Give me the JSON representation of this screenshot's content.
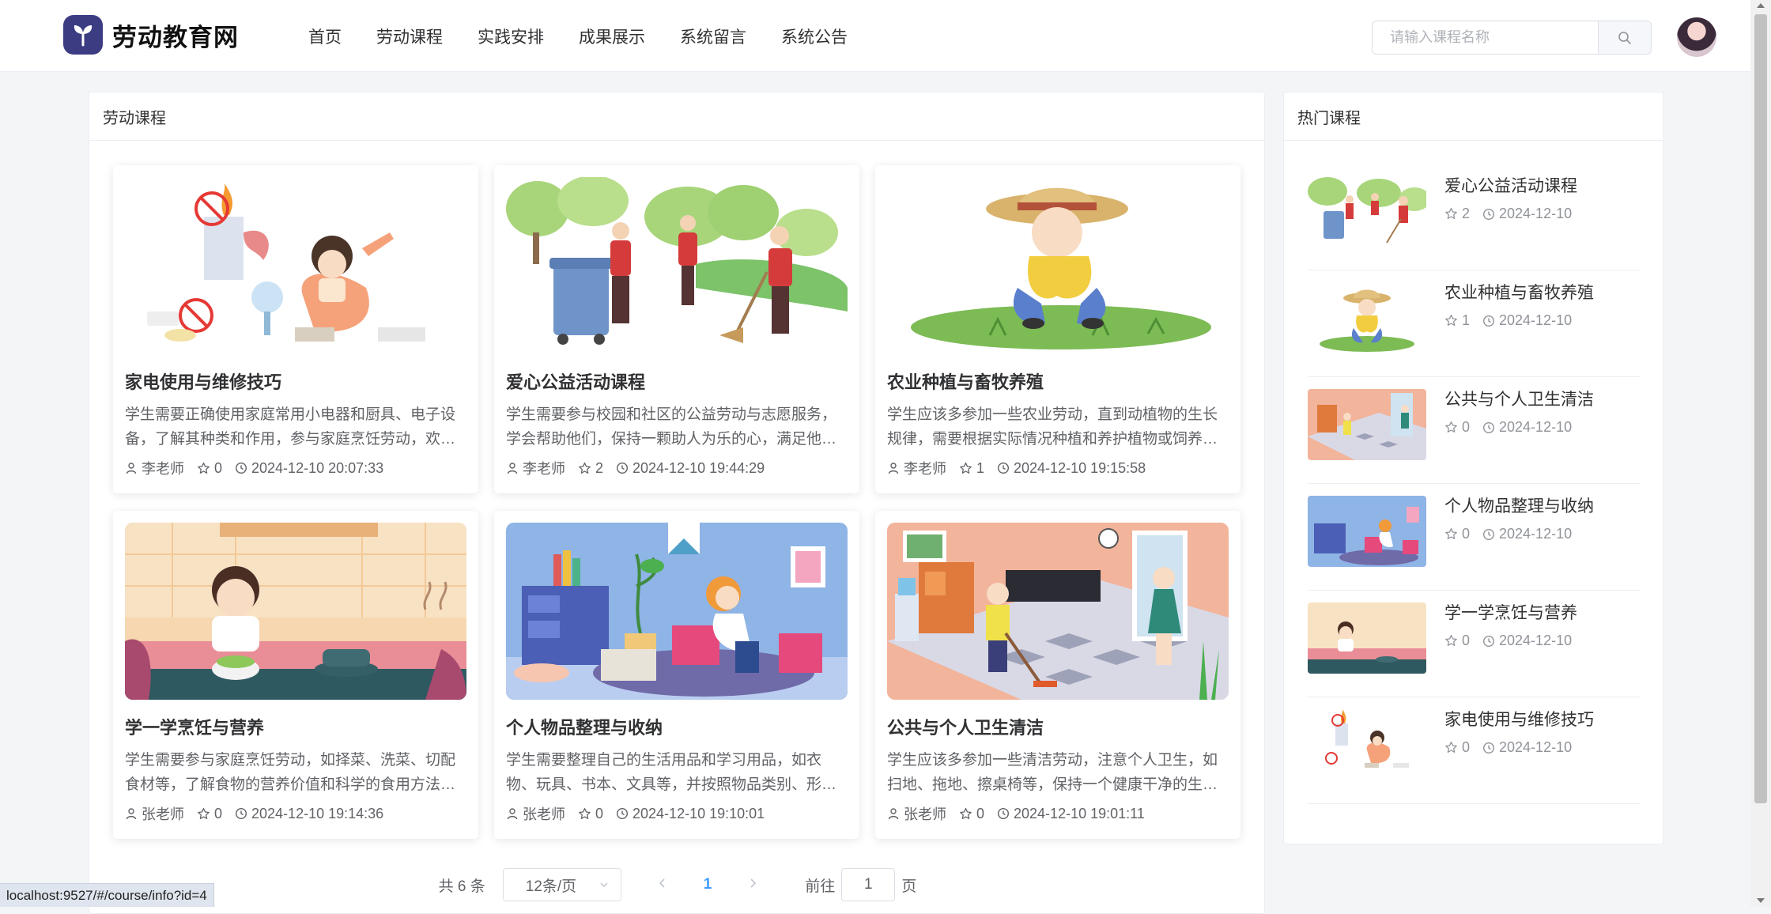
{
  "brand": {
    "name": "劳动教育网",
    "logo_icon": "heart-leaf-icon",
    "accent": "#3c3c83"
  },
  "nav": {
    "items": [
      {
        "label": "首页"
      },
      {
        "label": "劳动课程"
      },
      {
        "label": "实践安排"
      },
      {
        "label": "成果展示"
      },
      {
        "label": "系统留言"
      },
      {
        "label": "系统公告"
      }
    ]
  },
  "search": {
    "placeholder": "请输入课程名称",
    "value": "",
    "icon": "search-icon"
  },
  "main": {
    "title": "劳动课程",
    "courses": [
      {
        "title": "家电使用与维修技巧",
        "desc": "学生需要正确使用家庭常用小电器和厨具、电子设备，了解其种类和作用，参与家庭烹饪劳动，欢迎大家参加",
        "author": "李老师",
        "stars": "0",
        "time": "2024-12-10 20:07:33"
      },
      {
        "title": "爱心公益活动课程",
        "desc": "学生需要参与校园和社区的公益劳动与志愿服务，学会帮助他们，保持一颗助人为乐的心，满足他人的需要",
        "author": "李老师",
        "stars": "2",
        "time": "2024-12-10 19:44:29"
      },
      {
        "title": "农业种植与畜牧养殖",
        "desc": "学生应该多参加一些农业劳动，直到动植物的生长规律，需要根据实际情况种植和养护植物或饲养动物",
        "author": "李老师",
        "stars": "1",
        "time": "2024-12-10 19:15:58"
      },
      {
        "title": "学一学烹饪与营养",
        "desc": "学生需要参与家庭烹饪劳动，如择菜、洗菜、切配食材等，了解食物的营养价值和科学的食用方法等知识",
        "author": "张老师",
        "stars": "0",
        "time": "2024-12-10 19:14:36"
      },
      {
        "title": "个人物品整理与收纳",
        "desc": "学生需要整理自己的生活用品和学习用品，如衣物、玩具、书本、文具等，并按照物品类别、形状分类收纳",
        "author": "张老师",
        "stars": "0",
        "time": "2024-12-10 19:10:01"
      },
      {
        "title": "公共与个人卫生清洁",
        "desc": "学生应该多参加一些清洁劳动，注意个人卫生，如扫地、拖地、擦桌椅等，保持一个健康干净的生活环境",
        "author": "张老师",
        "stars": "0",
        "time": "2024-12-10 19:01:11"
      }
    ],
    "pagination": {
      "total_text": "共 6 条",
      "page_size": "12条/页",
      "current_page": "1",
      "goto_prefix": "前往",
      "goto_value": "1",
      "goto_suffix": "页"
    }
  },
  "sidebar": {
    "title": "热门课程",
    "items": [
      {
        "title": "爱心公益活动课程",
        "stars": "2",
        "date": "2024-12-10"
      },
      {
        "title": "农业种植与畜牧养殖",
        "stars": "1",
        "date": "2024-12-10"
      },
      {
        "title": "公共与个人卫生清洁",
        "stars": "0",
        "date": "2024-12-10"
      },
      {
        "title": "个人物品整理与收纳",
        "stars": "0",
        "date": "2024-12-10"
      },
      {
        "title": "学一学烹饪与营养",
        "stars": "0",
        "date": "2024-12-10"
      },
      {
        "title": "家电使用与维修技巧",
        "stars": "0",
        "date": "2024-12-10"
      }
    ]
  },
  "status_bar": {
    "url": "localhost:9527/#/course/info?id=4"
  }
}
